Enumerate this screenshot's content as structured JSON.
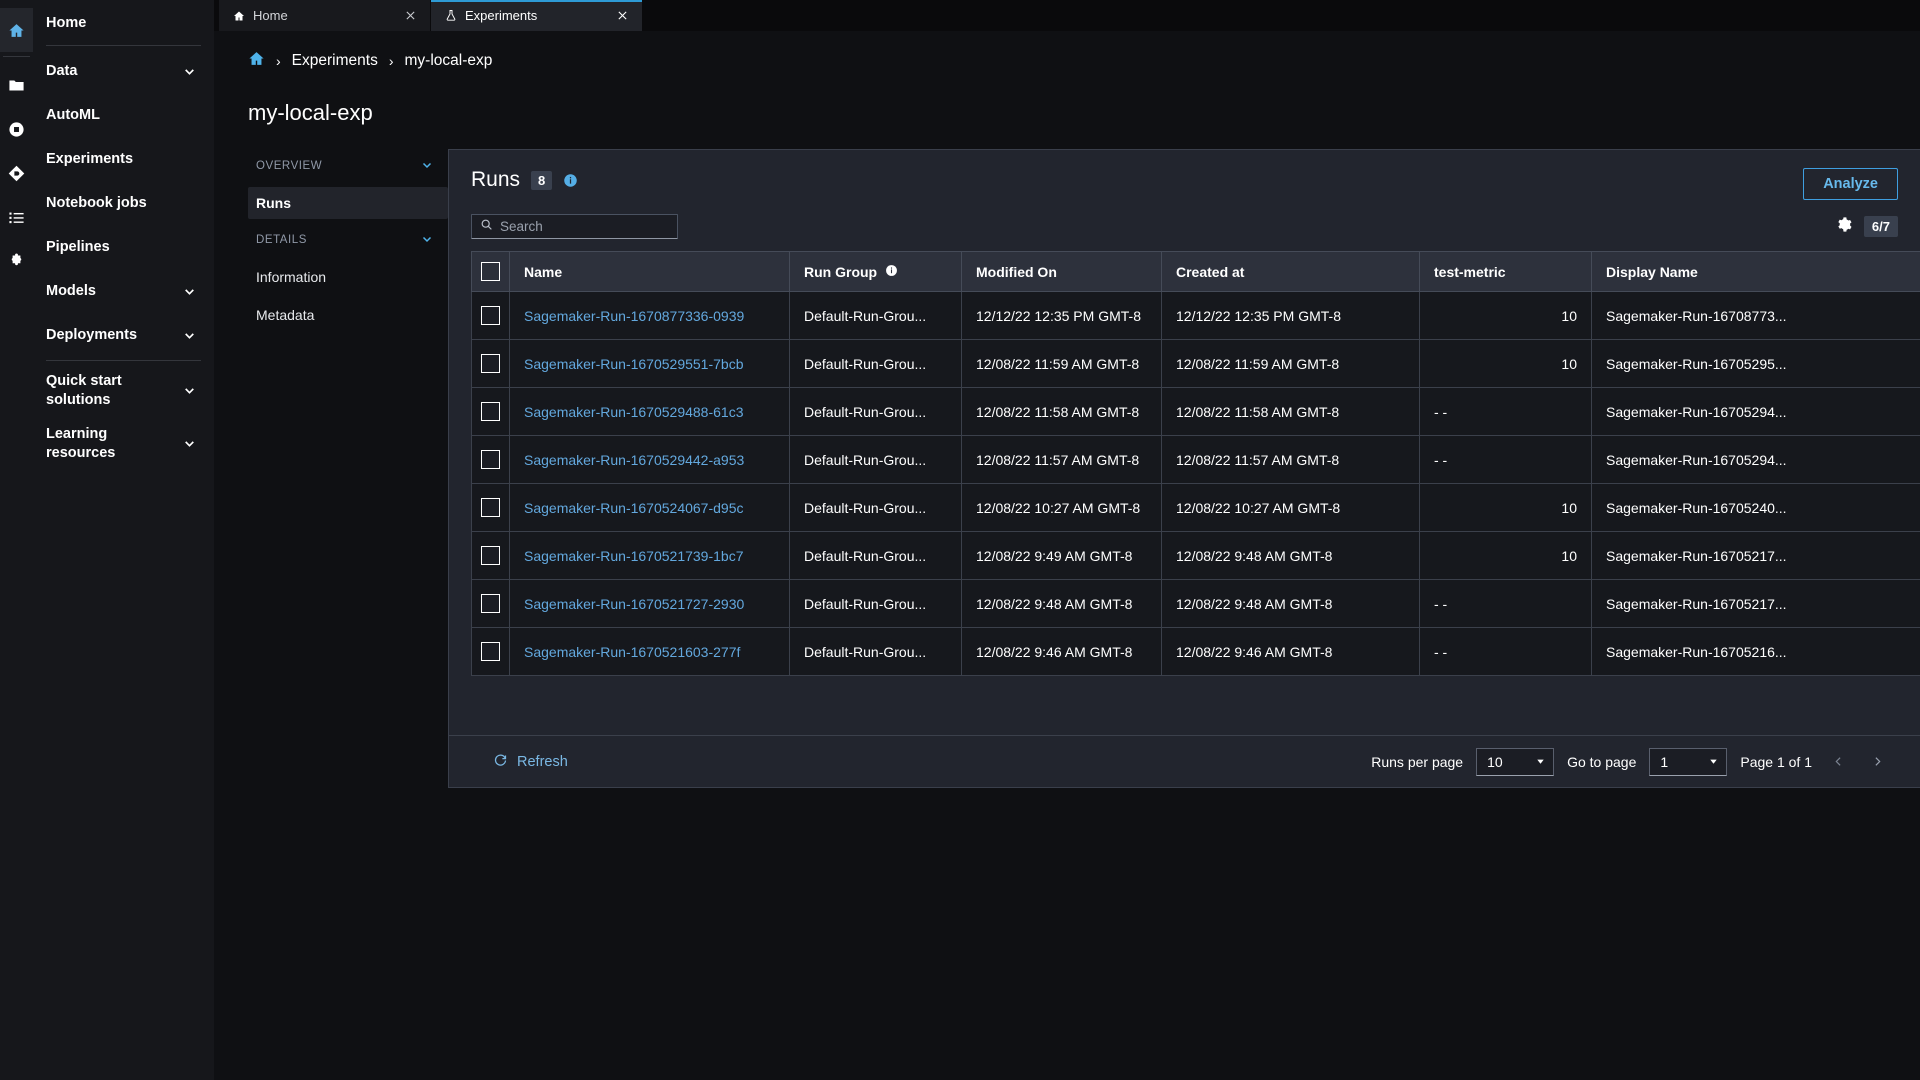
{
  "icon_rail": [
    {
      "name": "home-icon",
      "active": true
    },
    {
      "name": "folder-icon",
      "active": false
    },
    {
      "name": "stop-circle-icon",
      "active": false
    },
    {
      "name": "git-icon",
      "active": false
    },
    {
      "name": "list-icon",
      "active": false
    },
    {
      "name": "puzzle-icon",
      "active": false
    }
  ],
  "sidebar": {
    "items": [
      {
        "label": "Home",
        "expandable": false
      },
      {
        "label": "Data",
        "expandable": true
      },
      {
        "label": "AutoML",
        "expandable": false
      },
      {
        "label": "Experiments",
        "expandable": false
      },
      {
        "label": "Notebook jobs",
        "expandable": false
      },
      {
        "label": "Pipelines",
        "expandable": false
      },
      {
        "label": "Models",
        "expandable": true
      },
      {
        "label": "Deployments",
        "expandable": true
      },
      {
        "label": "Quick start solutions",
        "expandable": true
      },
      {
        "label": "Learning resources",
        "expandable": true
      }
    ]
  },
  "tabs": [
    {
      "label": "Home",
      "icon": "home-icon",
      "active": false
    },
    {
      "label": "Experiments",
      "icon": "flask-icon",
      "active": true
    }
  ],
  "breadcrumb": {
    "home_icon": "home-icon",
    "items": [
      "Experiments",
      "my-local-exp"
    ],
    "separator": "›"
  },
  "page": {
    "title": "my-local-exp"
  },
  "sub_nav": {
    "sections": [
      {
        "label": "OVERVIEW",
        "items": [
          {
            "label": "Runs",
            "selected": true
          }
        ]
      },
      {
        "label": "DETAILS",
        "items": [
          {
            "label": "Information",
            "selected": false
          },
          {
            "label": "Metadata",
            "selected": false
          }
        ]
      }
    ]
  },
  "runs_panel": {
    "title": "Runs",
    "count": "8",
    "info_icon": "info-icon",
    "analyze_label": "Analyze",
    "search_placeholder": "Search",
    "search_value": "",
    "settings_icon": "gear-icon",
    "column_count": "6/7",
    "columns": [
      {
        "key": "name",
        "label": "Name",
        "info": false
      },
      {
        "key": "run_group",
        "label": "Run Group",
        "info": true
      },
      {
        "key": "modified_on",
        "label": "Modified On",
        "info": false
      },
      {
        "key": "created_at",
        "label": "Created at",
        "info": false
      },
      {
        "key": "test_metric",
        "label": "test-metric",
        "info": false
      },
      {
        "key": "display_name",
        "label": "Display Name",
        "info": false
      }
    ],
    "rows": [
      {
        "name": "Sagemaker-Run-1670877336-0939",
        "run_group": "Default-Run-Grou...",
        "modified_on": "12/12/22 12:35 PM GMT-8",
        "created_at": "12/12/22 12:35 PM GMT-8",
        "test_metric": "10",
        "test_metric_numeric": true,
        "display_name": "Sagemaker-Run-16708773..."
      },
      {
        "name": "Sagemaker-Run-1670529551-7bcb",
        "run_group": "Default-Run-Grou...",
        "modified_on": "12/08/22 11:59 AM GMT-8",
        "created_at": "12/08/22 11:59 AM GMT-8",
        "test_metric": "10",
        "test_metric_numeric": true,
        "display_name": "Sagemaker-Run-16705295..."
      },
      {
        "name": "Sagemaker-Run-1670529488-61c3",
        "run_group": "Default-Run-Grou...",
        "modified_on": "12/08/22 11:58 AM GMT-8",
        "created_at": "12/08/22 11:58 AM GMT-8",
        "test_metric": "- -",
        "test_metric_numeric": false,
        "display_name": "Sagemaker-Run-16705294..."
      },
      {
        "name": "Sagemaker-Run-1670529442-a953",
        "run_group": "Default-Run-Grou...",
        "modified_on": "12/08/22 11:57 AM GMT-8",
        "created_at": "12/08/22 11:57 AM GMT-8",
        "test_metric": "- -",
        "test_metric_numeric": false,
        "display_name": "Sagemaker-Run-16705294..."
      },
      {
        "name": "Sagemaker-Run-1670524067-d95c",
        "run_group": "Default-Run-Grou...",
        "modified_on": "12/08/22 10:27 AM GMT-8",
        "created_at": "12/08/22 10:27 AM GMT-8",
        "test_metric": "10",
        "test_metric_numeric": true,
        "display_name": "Sagemaker-Run-16705240..."
      },
      {
        "name": "Sagemaker-Run-1670521739-1bc7",
        "run_group": "Default-Run-Grou...",
        "modified_on": "12/08/22 9:49 AM GMT-8",
        "created_at": "12/08/22 9:48 AM GMT-8",
        "test_metric": "10",
        "test_metric_numeric": true,
        "display_name": "Sagemaker-Run-16705217..."
      },
      {
        "name": "Sagemaker-Run-1670521727-2930",
        "run_group": "Default-Run-Grou...",
        "modified_on": "12/08/22 9:48 AM GMT-8",
        "created_at": "12/08/22 9:48 AM GMT-8",
        "test_metric": "- -",
        "test_metric_numeric": false,
        "display_name": "Sagemaker-Run-16705217..."
      },
      {
        "name": "Sagemaker-Run-1670521603-277f",
        "run_group": "Default-Run-Grou...",
        "modified_on": "12/08/22 9:46 AM GMT-8",
        "created_at": "12/08/22 9:46 AM GMT-8",
        "test_metric": "- -",
        "test_metric_numeric": false,
        "display_name": "Sagemaker-Run-16705216..."
      }
    ],
    "footer": {
      "refresh_label": "Refresh",
      "runs_per_page_label": "Runs per page",
      "runs_per_page_value": "10",
      "go_to_page_label": "Go to page",
      "go_to_page_value": "1",
      "page_status": "Page 1 of 1"
    }
  },
  "colors": {
    "accent_blue": "#63a8de",
    "link_blue": "#67b9ec",
    "panel_bg": "#22252e",
    "row_bg": "#16181d",
    "header_bg": "#2d313c"
  }
}
